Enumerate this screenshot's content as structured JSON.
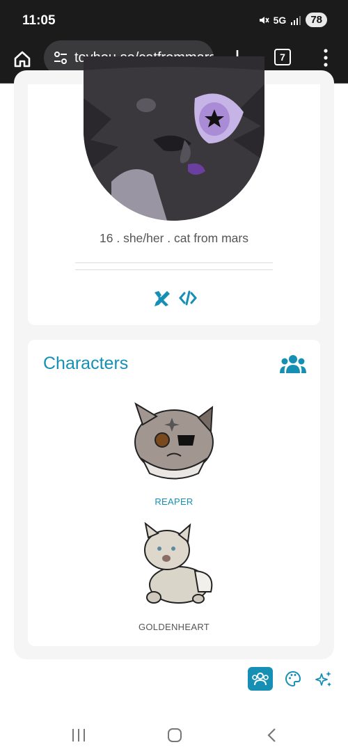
{
  "status": {
    "time": "11:05",
    "network": "5G",
    "battery": "78"
  },
  "browser": {
    "url": "toyhou.se/catfrommars",
    "tab_count": "7"
  },
  "profile": {
    "bio": "16 . she/her . cat from mars"
  },
  "characters": {
    "title": "Characters",
    "items": [
      {
        "name": "REAPER",
        "linked": true
      },
      {
        "name": "GOLDENHEART",
        "linked": false
      }
    ]
  },
  "colors": {
    "accent": "#1590b4",
    "status_bar": "#1b1b1b",
    "card_bg": "#f5f5f5"
  }
}
